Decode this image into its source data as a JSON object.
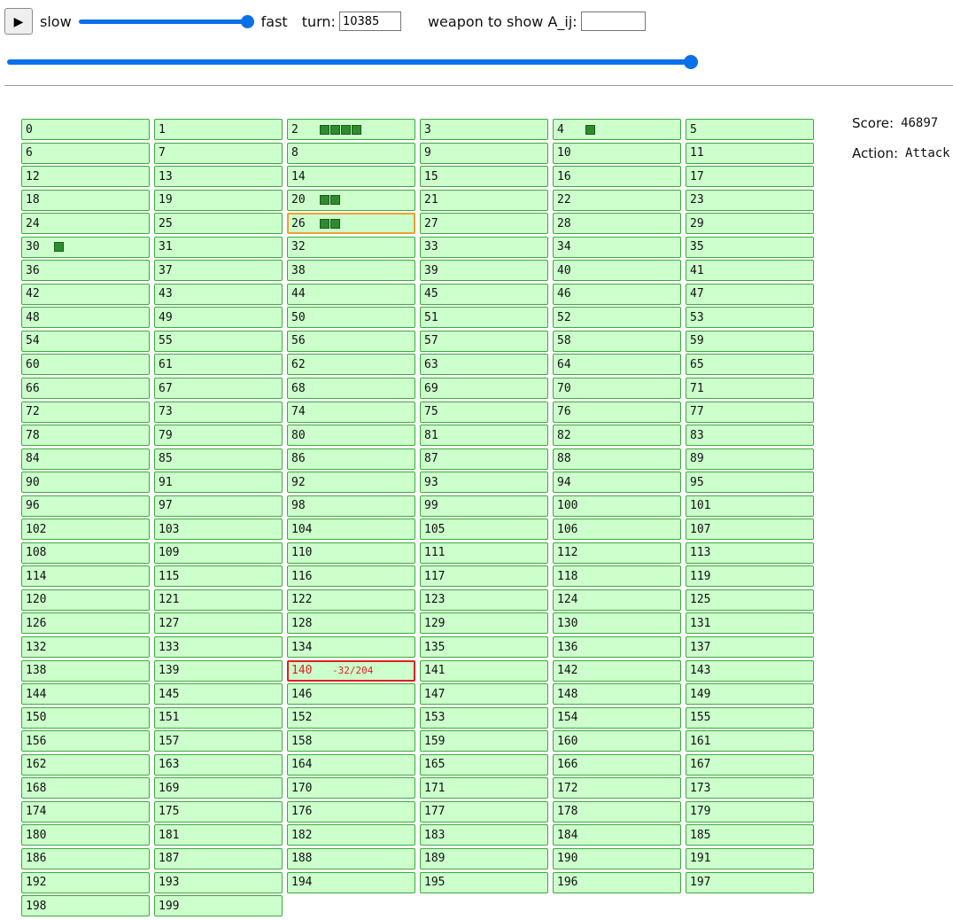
{
  "controls": {
    "play_icon": "▶",
    "slow_label": "slow",
    "fast_label": "fast",
    "turn_label": "turn:",
    "turn_value": "10385",
    "weapon_label": "weapon to show A_ij:",
    "weapon_value": "",
    "speed_level": 1.0,
    "turn_progress": 1.0
  },
  "colors": {
    "cell_bg": "#ccffcc",
    "cell_border": "#3caa3c",
    "weapon_square": "#2e8b2e",
    "highlight_active": "#f0a030",
    "highlight_alert": "#e02020",
    "slider": "#0a70ea"
  },
  "cells_count": 200,
  "cells_special": {
    "2": {
      "weapons": 4
    },
    "4": {
      "weapons": 1
    },
    "20": {
      "weapons": 2
    },
    "26": {
      "weapons": 2,
      "state": "active"
    },
    "30": {
      "weapons": 1
    },
    "140": {
      "hp": "-32/204",
      "state": "alert"
    }
  },
  "info": {
    "score_label": "Score:",
    "score_value": "46897",
    "action_label": "Action:",
    "action_value": "Attack"
  }
}
